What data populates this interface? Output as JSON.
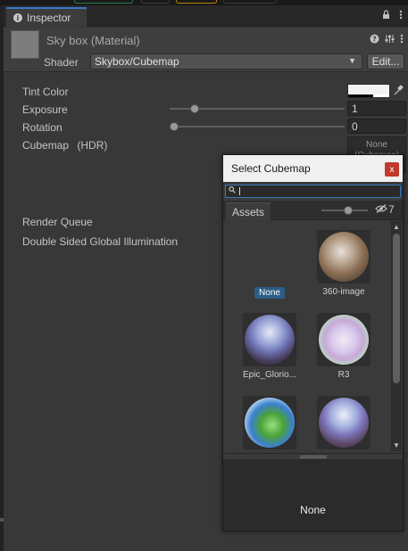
{
  "window": {
    "tab_title": "Inspector"
  },
  "header": {
    "material_title": "Sky box (Material)",
    "shader_label": "Shader",
    "shader_value": "Skybox/Cubemap",
    "edit_label": "Edit..."
  },
  "properties": {
    "tint_color_label": "Tint Color",
    "exposure_label": "Exposure",
    "exposure_value": "1",
    "rotation_label": "Rotation",
    "rotation_value": "0",
    "cubemap_label": "Cubemap",
    "cubemap_hdr": "(HDR)",
    "cubemap_field_line1": "None",
    "cubemap_field_line2": "(Cubemap)",
    "render_queue_label": "Render Queue",
    "double_sided_gi_label": "Double Sided Global Illumination"
  },
  "popup": {
    "title": "Select Cubemap",
    "close_glyph": "x",
    "search_value": "",
    "assets_tab": "Assets",
    "hidden_count": "7",
    "items": [
      {
        "label": "None",
        "selected": true
      },
      {
        "label": "360-image",
        "selected": false
      },
      {
        "label": "Epic_Glorio...",
        "selected": false
      },
      {
        "label": "R3",
        "selected": false
      },
      {
        "label": "",
        "selected": false
      },
      {
        "label": "",
        "selected": false
      }
    ],
    "preview_name": "None"
  }
}
